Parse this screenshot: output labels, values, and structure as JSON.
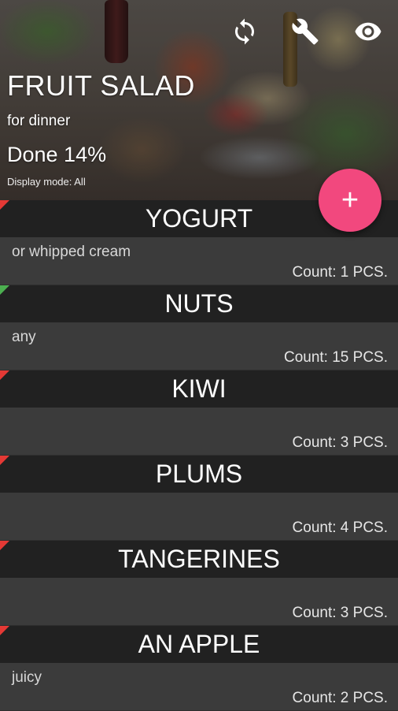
{
  "header": {
    "title": "FRUIT SALAD",
    "subtitle": "for dinner",
    "progress": "Done 14%",
    "progress_value": 14,
    "display_mode": "Display mode: All",
    "icons": [
      "sync-icon",
      "wrench-icon",
      "eye-icon"
    ]
  },
  "fab": {
    "label": "+"
  },
  "colors": {
    "fab": "#f2487e",
    "status_pending": "#e53935",
    "status_done": "#4caf50",
    "item_header": "#212121",
    "item_body": "#3b3b3b"
  },
  "items": [
    {
      "name": "YOGURT",
      "note": "or whipped cream",
      "count": "Count: 1 PCS.",
      "status": "pending"
    },
    {
      "name": "NUTS",
      "note": "any",
      "count": "Count: 15 PCS.",
      "status": "done"
    },
    {
      "name": "KIWI",
      "note": "",
      "count": "Count: 3 PCS.",
      "status": "pending"
    },
    {
      "name": "PLUMS",
      "note": "",
      "count": "Count: 4 PCS.",
      "status": "pending"
    },
    {
      "name": "TANGERINES",
      "note": "",
      "count": "Count: 3 PCS.",
      "status": "pending"
    },
    {
      "name": "AN APPLE",
      "note": "juicy",
      "count": "Count: 2 PCS.",
      "status": "pending"
    }
  ]
}
